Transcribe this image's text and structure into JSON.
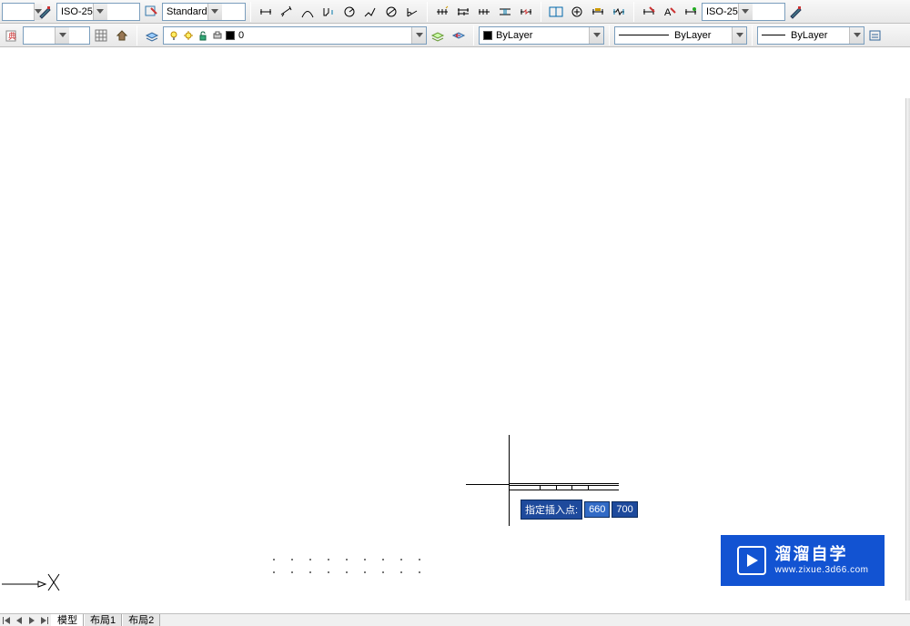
{
  "toolbar1": {
    "dimstyle_dropdown": "ISO-25",
    "textstyle_dropdown": "Standard",
    "dimstyle2_dropdown": "ISO-25"
  },
  "toolbar2": {
    "layer_dropdown": {
      "value": "0",
      "swatch_color": "#000000"
    },
    "color_dropdown": {
      "label": "ByLayer",
      "swatch_color": "#000000"
    },
    "linetype_dropdown": {
      "label": "ByLayer"
    },
    "lineweight_dropdown": {
      "label": "ByLayer"
    }
  },
  "dynamic_input": {
    "prompt": "指定插入点:",
    "value1": "660",
    "value2": "700"
  },
  "tabs": {
    "model": "模型",
    "layout1": "布局1",
    "layout2": "布局2"
  },
  "watermark": {
    "title": "溜溜自学",
    "url": "www.zixue.3d66.com"
  }
}
